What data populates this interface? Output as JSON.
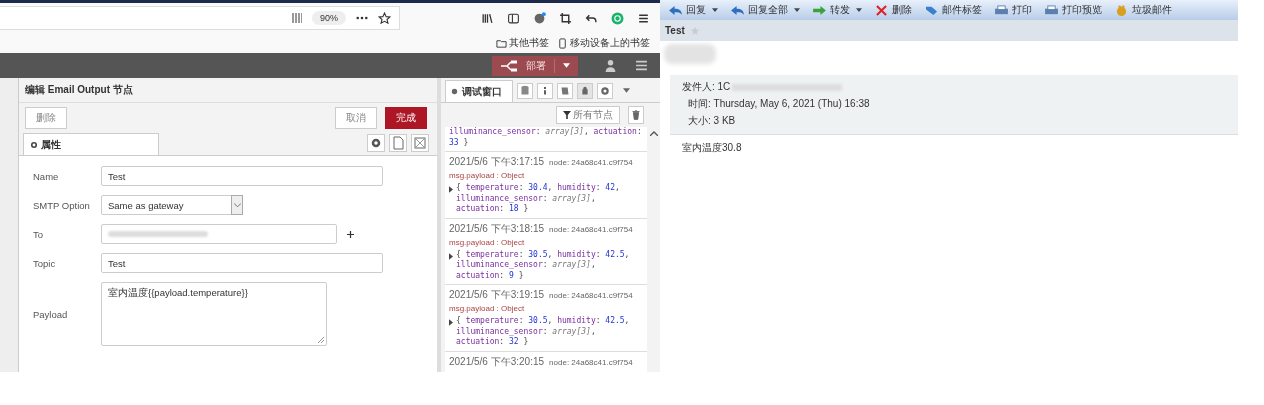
{
  "browser": {
    "zoom": "90%",
    "bookmarks": [
      "其他书签",
      "移动设备上的书签"
    ]
  },
  "nodered": {
    "deploy": "部署",
    "editor": {
      "title": "编辑 Email Output 节点",
      "delete": "删除",
      "cancel": "取消",
      "done": "完成",
      "tab": "属性",
      "fields": [
        {
          "kind": "text",
          "label": "Name",
          "value": "Test"
        },
        {
          "kind": "select",
          "label": "SMTP Option",
          "value": "Same as gateway"
        },
        {
          "kind": "hidden",
          "label": "To"
        },
        {
          "kind": "text",
          "label": "Topic",
          "value": "Test"
        },
        {
          "kind": "textarea",
          "label": "Payload",
          "value": "室内温度{{payload.temperature}}"
        }
      ]
    },
    "debug": {
      "tab": "调试窗口",
      "filter": "所有节点",
      "messages": [
        {
          "kind": "partial",
          "payload": "illuminance_sensor: array[3], actuation: 33 }"
        },
        {
          "kind": "full",
          "time": "2021/5/6 下午3:17:15",
          "node": "node: 24a68c41.c9f754",
          "type": "msg.payload : Object",
          "payload": "{ temperature: 30.4, humidity: 42, illuminance_sensor: array[3], actuation: 18 }"
        },
        {
          "kind": "full",
          "time": "2021/5/6 下午3:18:15",
          "node": "node: 24a68c41.c9f754",
          "type": "msg.payload : Object",
          "payload": "{ temperature: 30.5, humidity: 42.5, illuminance_sensor: array[3], actuation: 9 }"
        },
        {
          "kind": "full",
          "time": "2021/5/6 下午3:19:15",
          "node": "node: 24a68c41.c9f754",
          "type": "msg.payload : Object",
          "payload": "{ temperature: 30.5, humidity: 42.5, illuminance_sensor: array[3], actuation: 32 }"
        },
        {
          "kind": "header",
          "time": "2021/5/6 下午3:20:15",
          "node": "node: 24a68c41.c9f754"
        }
      ]
    }
  },
  "mail": {
    "toolbar": [
      {
        "kind": "reply",
        "label": "回复",
        "menu": true
      },
      {
        "kind": "reply-all",
        "label": "回复全部",
        "menu": true
      },
      {
        "kind": "forward",
        "label": "转发",
        "menu": true
      },
      {
        "kind": "delete",
        "label": "删除",
        "menu": false
      },
      {
        "kind": "tag",
        "label": "邮件标签",
        "menu": false
      },
      {
        "kind": "print",
        "label": "打印",
        "menu": false
      },
      {
        "kind": "print",
        "label": "打印预览",
        "menu": false
      },
      {
        "kind": "junk",
        "label": "垃圾邮件",
        "menu": false
      }
    ],
    "subject": "Test",
    "starred": false,
    "meta": [
      {
        "label": "发件人:",
        "value": "1C",
        "hidden_rest": true
      },
      {
        "label": "时间:",
        "value": "Thursday, May 6, 2021 (Thu) 16:38",
        "hidden_rest": false
      },
      {
        "label": "大小:",
        "value": "3 KB",
        "hidden_rest": false
      }
    ],
    "body": "室内温度30.8"
  }
}
